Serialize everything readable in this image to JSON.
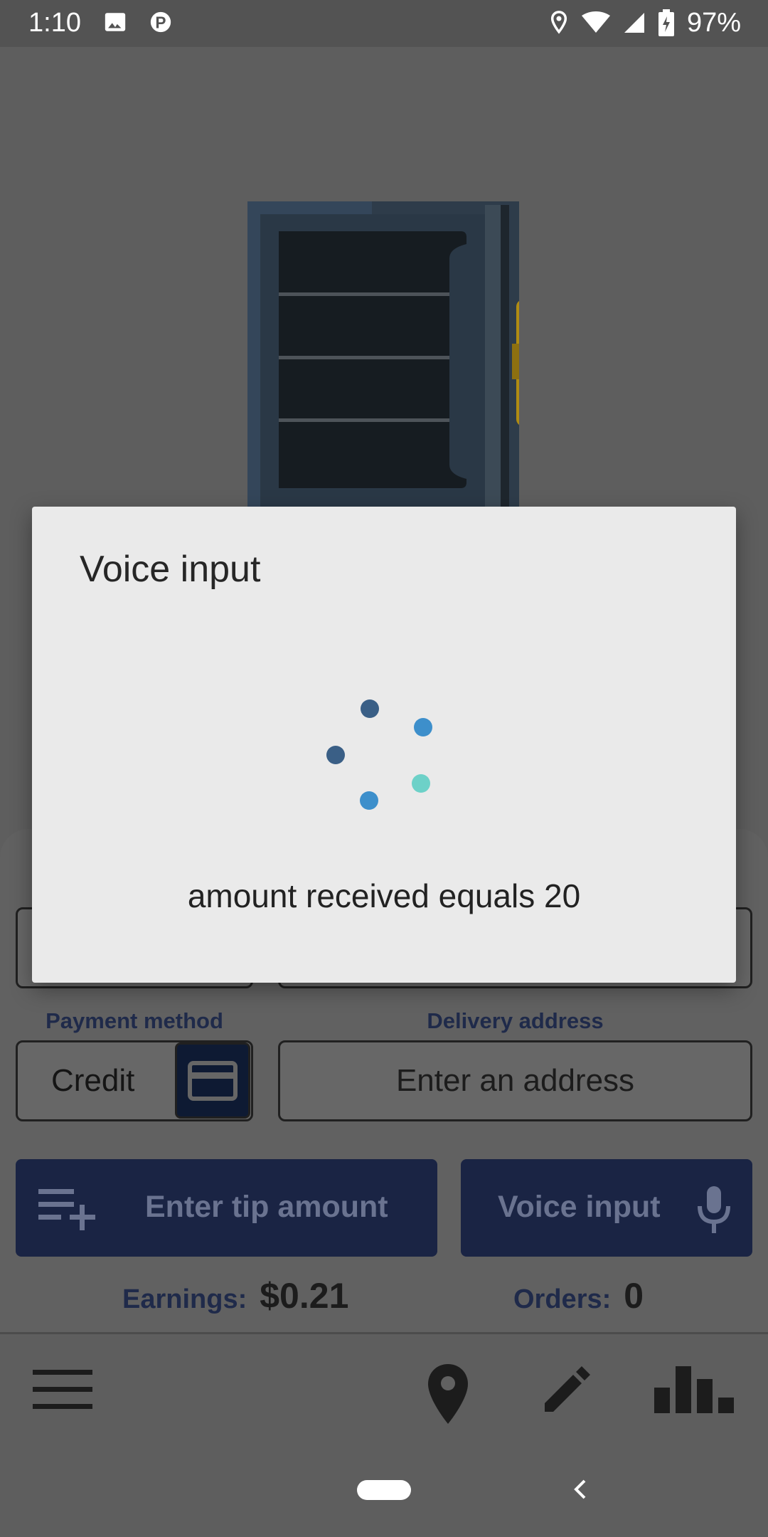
{
  "status_bar": {
    "time": "1:10",
    "battery": "97%"
  },
  "form": {
    "payment_label": "Payment method",
    "payment_value": "Credit",
    "address_label": "Delivery address",
    "address_placeholder": "Enter an address",
    "tip_button": "Enter tip amount",
    "voice_button": "Voice input",
    "earnings_label": "Earnings:",
    "earnings_value": "$0.21",
    "orders_label": "Orders:",
    "orders_value": "0"
  },
  "dialog": {
    "title": "Voice input",
    "transcript": "amount received equals 20"
  },
  "colors": {
    "accent": "#1a2444",
    "dot_dark": "#3a5f86",
    "dot_blue": "#3d8fcb",
    "dot_teal": "#6dd1c8"
  }
}
